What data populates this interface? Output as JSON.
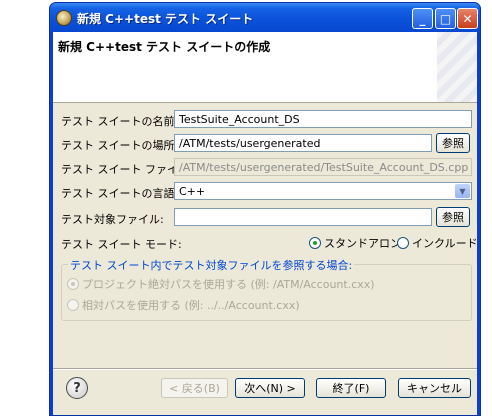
{
  "window": {
    "title": "新規 C++test テスト スイート"
  },
  "banner": {
    "title": "新規 C++test テスト スイートの作成"
  },
  "form": {
    "name_label": "テスト スイートの名前:",
    "name_value": "TestSuite_Account_DS",
    "location_label": "テスト スイートの場所:",
    "location_value": "/ATM/tests/usergenerated",
    "browse_label": "参照",
    "file_label": "テスト スイート ファイル:",
    "file_value": "/ATM/tests/usergenerated/TestSuite_Account_DS.cpp",
    "language_label": "テスト スイートの言語:",
    "language_value": "C++",
    "target_label": "テスト対象ファイル:",
    "target_value": "",
    "target_browse_label": "参照",
    "mode_label": "テスト スイート モード:",
    "mode_options": [
      "スタンドアロン",
      "インクルード"
    ],
    "mode_selected": "スタンドアロン"
  },
  "group": {
    "legend": "テスト スイート内でテスト対象ファイルを参照する場合:",
    "options": [
      "プロジェクト絶対パスを使用する (例: /ATM/Account.cxx)",
      "相対パスを使用する (例: ../../Account.cxx)"
    ],
    "selected_index": 0
  },
  "footer": {
    "back_label": "< 戻る(B)",
    "next_label": "次へ(N) >",
    "finish_label": "終了(F)",
    "cancel_label": "キャンセル"
  },
  "icons": {
    "app": "eclipse-icon",
    "help": "help-icon"
  }
}
